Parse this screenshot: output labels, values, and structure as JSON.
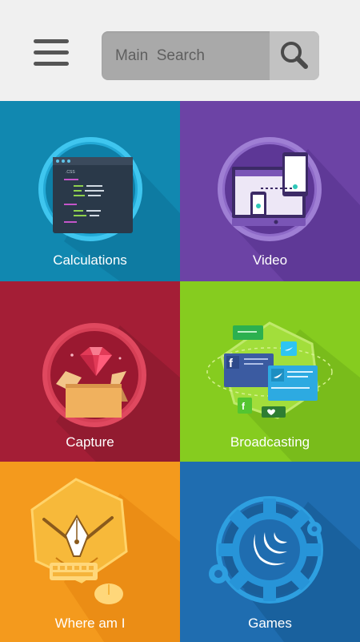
{
  "header": {
    "menu_icon": "hamburger-menu-icon",
    "search": {
      "placeholder": "Main  Search",
      "icon": "magnifier-icon"
    }
  },
  "tiles": [
    {
      "label": "Calculations",
      "color": "#1188b0",
      "icon": "code-screen-icon"
    },
    {
      "label": "Video",
      "color": "#6c43a5",
      "icon": "devices-icon"
    },
    {
      "label": "Capture",
      "color": "#a41e36",
      "icon": "gem-box-icon"
    },
    {
      "label": "Broadcasting",
      "color": "#86cc1f",
      "icon": "social-cards-icon"
    },
    {
      "label": "Where am I",
      "color": "#f49a1d",
      "icon": "pen-tool-icon"
    },
    {
      "label": "Games",
      "color": "#1f6db0",
      "icon": "gear-logo-icon"
    }
  ],
  "social": {
    "facebook": "f",
    "twitter": "twitter-bird-icon"
  },
  "code_tab": ".CSS"
}
